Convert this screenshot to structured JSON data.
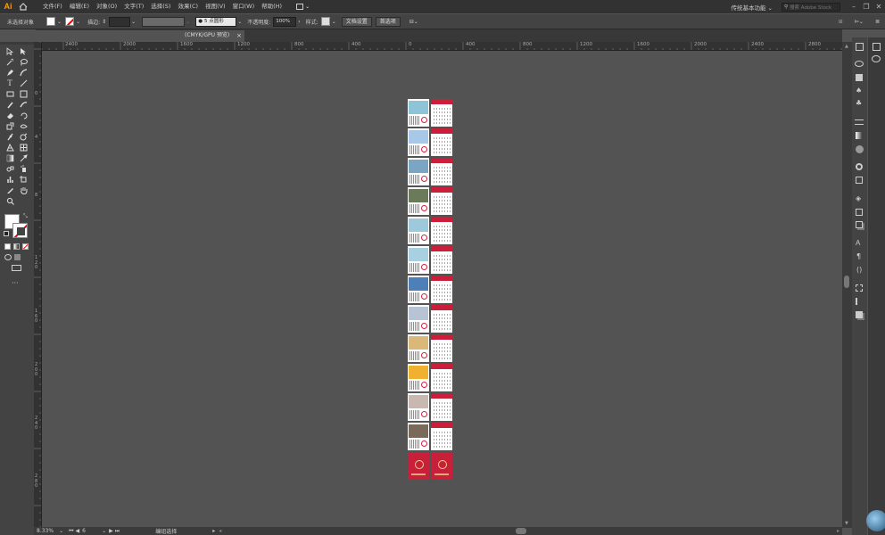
{
  "app": {
    "logo": "Ai"
  },
  "menu": {
    "items": [
      "文件(F)",
      "编辑(E)",
      "对象(O)",
      "文字(T)",
      "选择(S)",
      "效果(C)",
      "视图(V)",
      "窗口(W)",
      "帮助(H)"
    ],
    "workspace": "传统基本功能",
    "search_placeholder": "搜索 Adobe Stock"
  },
  "control": {
    "selection_status": "未选择对象",
    "stroke_label": "描边:",
    "brush": "5 点圆形",
    "opacity_label": "不透明度:",
    "opacity_value": "100%",
    "style_label": "样式:",
    "doc_setup_button": "文档设置",
    "prefs_button": "首选项"
  },
  "document": {
    "tab_title": "(CMYK/GPU 预览)",
    "close": "×"
  },
  "ruler": {
    "h_labels": [
      "2400",
      "2000",
      "1600",
      "1200",
      "800",
      "400",
      "0",
      "400",
      "800",
      "1200",
      "1600",
      "2000",
      "2400",
      "2800"
    ],
    "v_labels": [
      "0",
      "4",
      "8",
      "1 2 0",
      "1 6 0",
      "2 0 0",
      "2 4 0",
      "2 8 0"
    ]
  },
  "status": {
    "zoom": "8.33%",
    "page": "6",
    "mode": "编组选择"
  },
  "calendar": {
    "pages": 13
  }
}
